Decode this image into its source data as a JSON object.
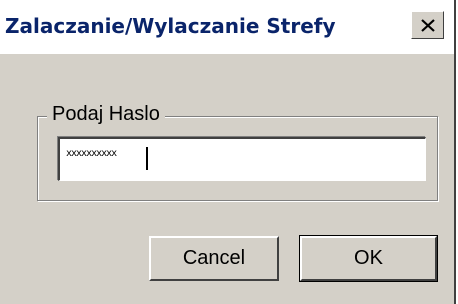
{
  "window": {
    "title": "Zalaczanie/Wylaczanie Strefy",
    "close_icon": "close-icon"
  },
  "group": {
    "label": "Podaj Haslo"
  },
  "password": {
    "value": "xxxxxxxxxx"
  },
  "buttons": {
    "cancel_label": "Cancel",
    "ok_label": "OK"
  },
  "colors": {
    "title_text": "#0a246a",
    "dialog_face": "#d4d0c8"
  }
}
